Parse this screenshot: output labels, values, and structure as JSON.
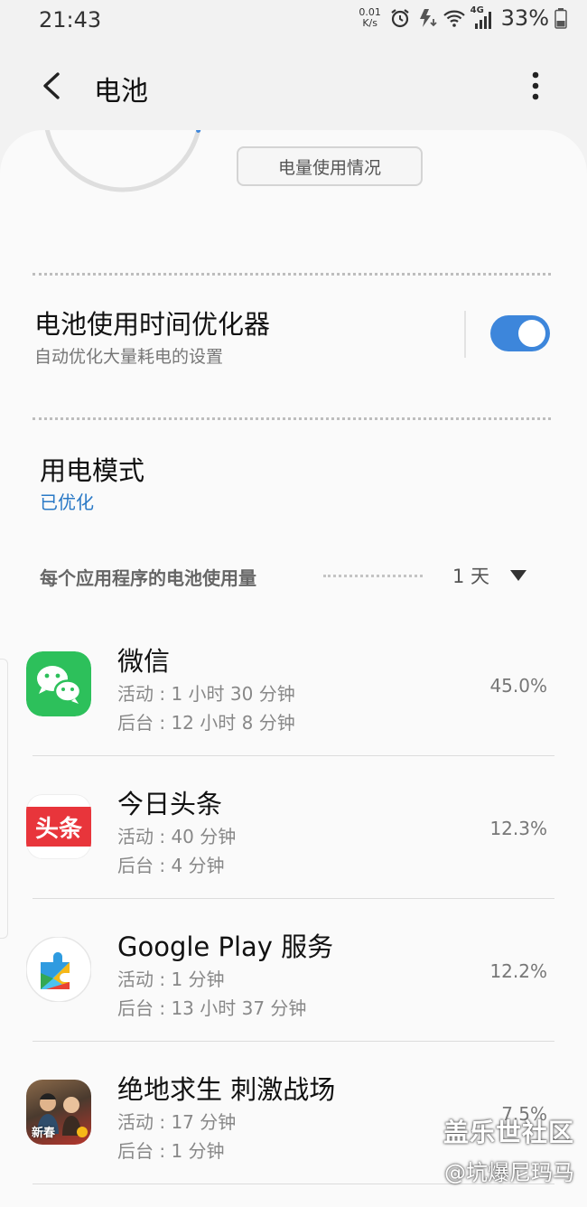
{
  "status_bar": {
    "time": "21:43",
    "net_speed_value": "0.01",
    "net_speed_unit": "K/s",
    "network_type": "4G",
    "battery_percent": "33%",
    "icons": [
      "alarm-icon",
      "data-saver-icon",
      "wifi-icon",
      "signal-icon",
      "battery-icon"
    ]
  },
  "app_bar": {
    "title": "电池",
    "icons": [
      "back-arrow-icon",
      "more-vertical-icon"
    ]
  },
  "summary": {
    "usage_button_label": "电量使用情况"
  },
  "optimizer": {
    "title": "电池使用时间优化器",
    "subtitle": "自动优化大量耗电的设置",
    "enabled": true
  },
  "power_mode": {
    "title": "用电模式",
    "value": "已优化"
  },
  "per_app": {
    "header": "每个应用程序的电池使用量",
    "period": "1 天",
    "apps": [
      {
        "name": "微信",
        "active": "活动 : 1 小时 30 分钟",
        "background": "后台 : 12 小时 8 分钟",
        "percent": "45.0%",
        "icon": "wechat-icon"
      },
      {
        "name": "今日头条",
        "active": "活动 : 40 分钟",
        "background": "后台 : 4 分钟",
        "percent": "12.3%",
        "icon": "toutiao-icon",
        "icon_text": "头条"
      },
      {
        "name": "Google Play 服务",
        "active": "活动 : 1 分钟",
        "background": "后台 : 13 小时 37 分钟",
        "percent": "12.2%",
        "icon": "google-play-services-icon"
      },
      {
        "name": "绝地求生 刺激战场",
        "active": "活动 : 17 分钟",
        "background": "后台 : 1 分钟",
        "percent": "7.5%",
        "icon": "pubg-mobile-icon",
        "icon_text": "新春"
      }
    ]
  },
  "colors": {
    "accent_blue": "#3d86db",
    "link_blue": "#2a79c6",
    "wechat_green": "#2dc05b",
    "toutiao_red": "#e8353b"
  },
  "watermark": {
    "line1": "盖乐世社区",
    "line2": "@坑爆尼玛马"
  }
}
